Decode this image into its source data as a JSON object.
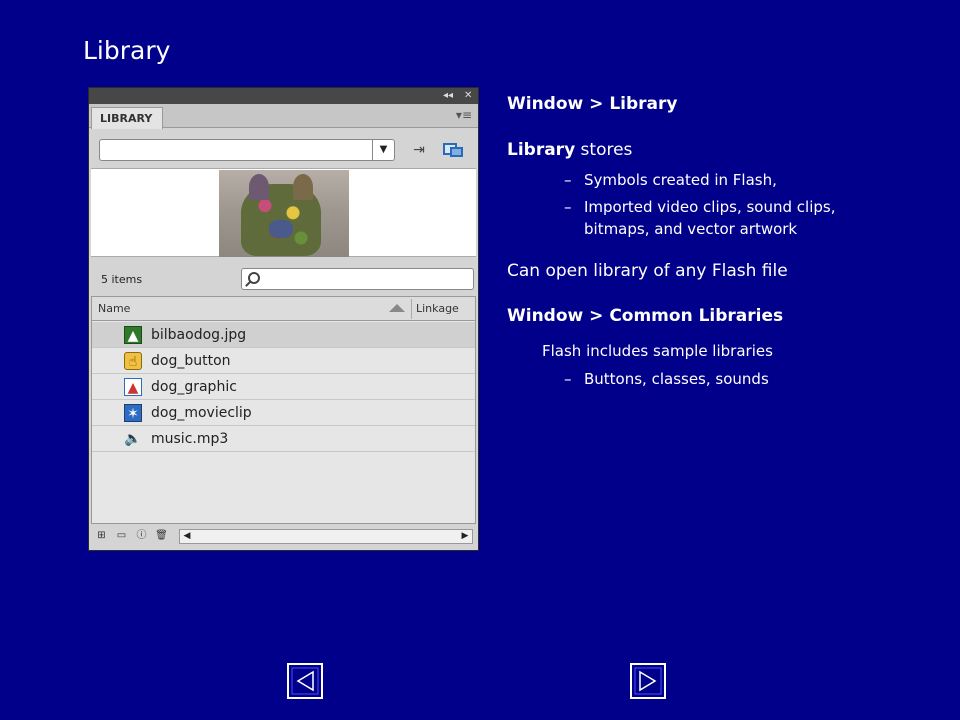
{
  "slide": {
    "title": "Library"
  },
  "panel": {
    "tab_label": "LIBRARY",
    "collapse_glyph": "◂◂",
    "close_glyph": "✕",
    "menu_glyph": "▾≡",
    "dropdown_arrow": "▼",
    "pin_glyph": "⇥",
    "item_count": "5 items",
    "columns": {
      "name": "Name",
      "linkage": "Linkage"
    },
    "items": [
      {
        "label": "bilbaodog.jpg",
        "icon": "bitmap-icon",
        "glyph": "▲",
        "selected": true
      },
      {
        "label": "dog_button",
        "icon": "button-symbol-icon",
        "glyph": "☝",
        "selected": false
      },
      {
        "label": "dog_graphic",
        "icon": "graphic-symbol-icon",
        "glyph": "▲",
        "selected": false
      },
      {
        "label": "dog_movieclip",
        "icon": "movieclip-symbol-icon",
        "glyph": "✶",
        "selected": false
      },
      {
        "label": "music.mp3",
        "icon": "sound-icon",
        "glyph": "🔈",
        "selected": false
      }
    ],
    "footer_icons": [
      {
        "name": "new-symbol-icon",
        "glyph": "⊞"
      },
      {
        "name": "new-folder-icon",
        "glyph": "▭"
      },
      {
        "name": "properties-icon",
        "glyph": "ⓘ"
      },
      {
        "name": "delete-icon",
        "glyph": "🗑"
      }
    ],
    "scroll_left": "◀",
    "scroll_right": "▶"
  },
  "notes": {
    "line1": "Window > Library",
    "line2_bold": "Library",
    "line2_rest": " stores",
    "bullet1": "Symbols created in Flash,",
    "bullet2a": "Imported video clips, sound clips,",
    "bullet2b": "bitmaps, and vector artwork",
    "line3": "Can open library of any Flash file",
    "line4": "Window > Common Libraries",
    "sub1": "Flash includes sample libraries",
    "bullet3": "Buttons, classes, sounds",
    "dash": "–"
  },
  "nav": {
    "prev_glyph": "◀",
    "next_glyph": "▶"
  },
  "colors": {
    "background": "#00008b",
    "text": "#ffffff",
    "panel": "#d4d4d4"
  }
}
